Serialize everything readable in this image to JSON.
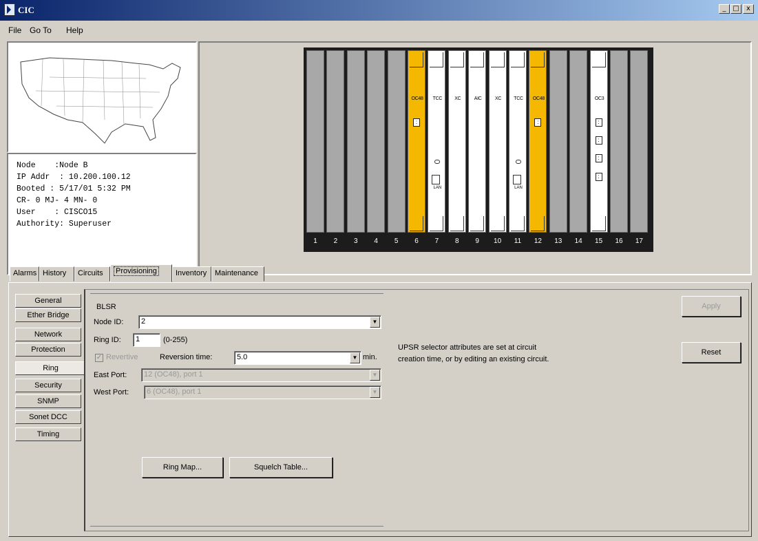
{
  "window": {
    "title": "CIC",
    "min": "_",
    "max": "□",
    "close": "x"
  },
  "menu": {
    "file": "File",
    "goto": "Go To",
    "help": "Help"
  },
  "node_info": {
    "node": "Node    :Node B",
    "ip": "IP Addr  : 10.200.100.12",
    "booted": "Booted : 5/17/01 5:32 PM",
    "alarms": "CR- 0 MJ- 4 MN- 0",
    "user": "User    : CISCO15",
    "authority": "Authority: Superuser"
  },
  "shelf": {
    "slot_numbers": [
      "1",
      "2",
      "3",
      "4",
      "5",
      "6",
      "7",
      "8",
      "9",
      "10",
      "11",
      "12",
      "13",
      "14",
      "15",
      "16",
      "17"
    ],
    "slot6_label": "OC48",
    "slot7_label": "TCC",
    "slot8_label": "XC",
    "slot9_label": "AIC",
    "slot10_label": "XC",
    "slot11_label": "TCC",
    "slot12_label": "OC48",
    "slot15_label": "OC3",
    "lan_label": "LAN",
    "oc48_color": "#f5b800",
    "empty_color": "#a8a8a8"
  },
  "tabs": [
    "Alarms",
    "History",
    "Circuits",
    "Provisioning",
    "Inventory",
    "Maintenance"
  ],
  "active_tab": "Provisioning",
  "side_menu": [
    "General",
    "Ether Bridge",
    "Network",
    "Protection",
    "Ring",
    "Security",
    "SNMP",
    "Sonet DCC",
    "Timing"
  ],
  "active_side": "Ring",
  "blsr": {
    "group_label": "BLSR",
    "node_id_label": "Node ID:",
    "node_id_value": "2",
    "ring_id_label": "Ring ID:",
    "ring_id_value": "1",
    "ring_id_range": "(0-255)",
    "revertive_label": "Revertive",
    "revertive_checked": true,
    "reversion_label": "Reversion time:",
    "reversion_value": "5.0",
    "reversion_unit": "min.",
    "east_label": "East Port:",
    "east_value": "12 (OC48), port 1",
    "west_label": "West Port:",
    "west_value": "6 (OC48), port 1"
  },
  "buttons": {
    "ring_map": "Ring Map...",
    "squelch": "Squelch Table...",
    "apply": "Apply",
    "reset": "Reset"
  },
  "note": "UPSR selector attributes are set at circuit creation time, or by editing an existing circuit."
}
